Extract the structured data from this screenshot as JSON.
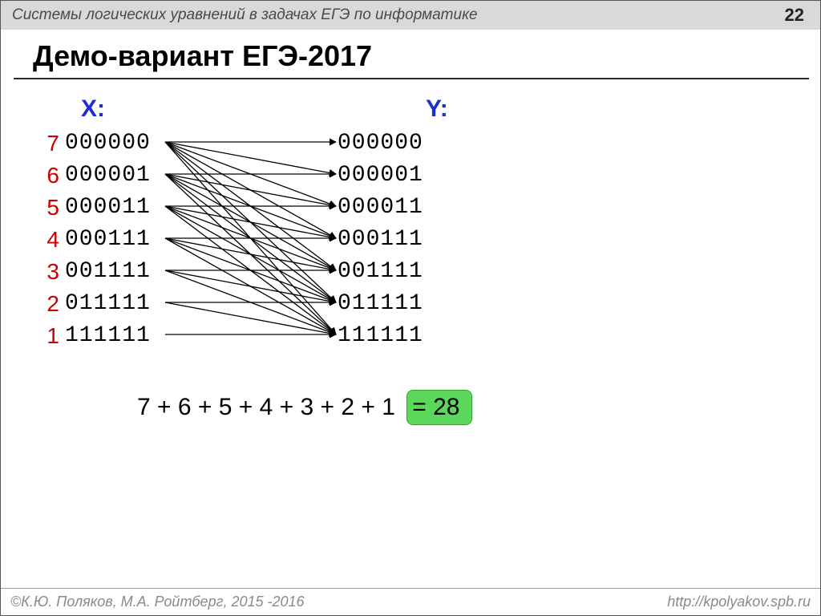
{
  "header": {
    "title": "Системы логических уравнений в задачах ЕГЭ по информатике",
    "page": "22"
  },
  "heading": "Демо-вариант ЕГЭ-2017",
  "labels": {
    "x": "X:",
    "y": "Y:"
  },
  "mapping": {
    "indices": [
      "7",
      "6",
      "5",
      "4",
      "3",
      "2",
      "1"
    ],
    "x": [
      "000000",
      "000001",
      "000011",
      "000111",
      "001111",
      "011111",
      "111111"
    ],
    "y": [
      "000000",
      "000001",
      "000011",
      "000111",
      "001111",
      "011111",
      "111111"
    ],
    "edges": [
      [
        0,
        0
      ],
      [
        0,
        1
      ],
      [
        0,
        2
      ],
      [
        0,
        3
      ],
      [
        0,
        4
      ],
      [
        0,
        5
      ],
      [
        0,
        6
      ],
      [
        1,
        1
      ],
      [
        1,
        2
      ],
      [
        1,
        3
      ],
      [
        1,
        4
      ],
      [
        1,
        5
      ],
      [
        1,
        6
      ],
      [
        2,
        2
      ],
      [
        2,
        3
      ],
      [
        2,
        4
      ],
      [
        2,
        5
      ],
      [
        2,
        6
      ],
      [
        3,
        3
      ],
      [
        3,
        4
      ],
      [
        3,
        5
      ],
      [
        3,
        6
      ],
      [
        4,
        4
      ],
      [
        4,
        5
      ],
      [
        4,
        6
      ],
      [
        5,
        5
      ],
      [
        5,
        6
      ],
      [
        6,
        6
      ]
    ]
  },
  "sum": {
    "expr": "7 + 6 + 5 + 4 + 3 + 2 + 1 ",
    "result": "= 28"
  },
  "footer": {
    "left": "К.Ю. Поляков, М.А. Ройтберг, 2015 -2016",
    "copy": "©",
    "right": "http://kpolyakov.spb.ru"
  }
}
